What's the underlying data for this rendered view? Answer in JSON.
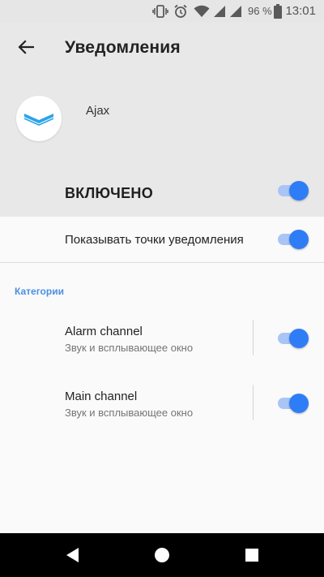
{
  "status_bar": {
    "icons": [
      "vibrate-icon",
      "alarm-icon",
      "wifi-icon",
      "signal-icon",
      "signal-icon",
      "battery-icon"
    ],
    "battery_percent": "96 %",
    "time": "13:01"
  },
  "header": {
    "back_icon": "arrow-back-icon",
    "title": "Уведомления",
    "app_name": "Ajax",
    "enabled_label": "ВКЛЮЧЕНО",
    "enabled": true
  },
  "notification_dots": {
    "label": "Показывать точки уведомления",
    "enabled": true
  },
  "categories": {
    "header": "Категории",
    "items": [
      {
        "title": "Alarm channel",
        "subtitle": "Звук и всплывающее окно",
        "enabled": true
      },
      {
        "title": "Main channel",
        "subtitle": "Звук и всплывающее окно",
        "enabled": true
      }
    ]
  },
  "nav_bar": {
    "buttons": [
      "back-icon",
      "home-icon",
      "recents-icon"
    ]
  },
  "colors": {
    "accent": "#2f7df6",
    "track": "#a9c5f5",
    "category_header": "#4a8fe2",
    "header_bg": "#e8e8e8",
    "app_logo": "#29a3e8"
  }
}
